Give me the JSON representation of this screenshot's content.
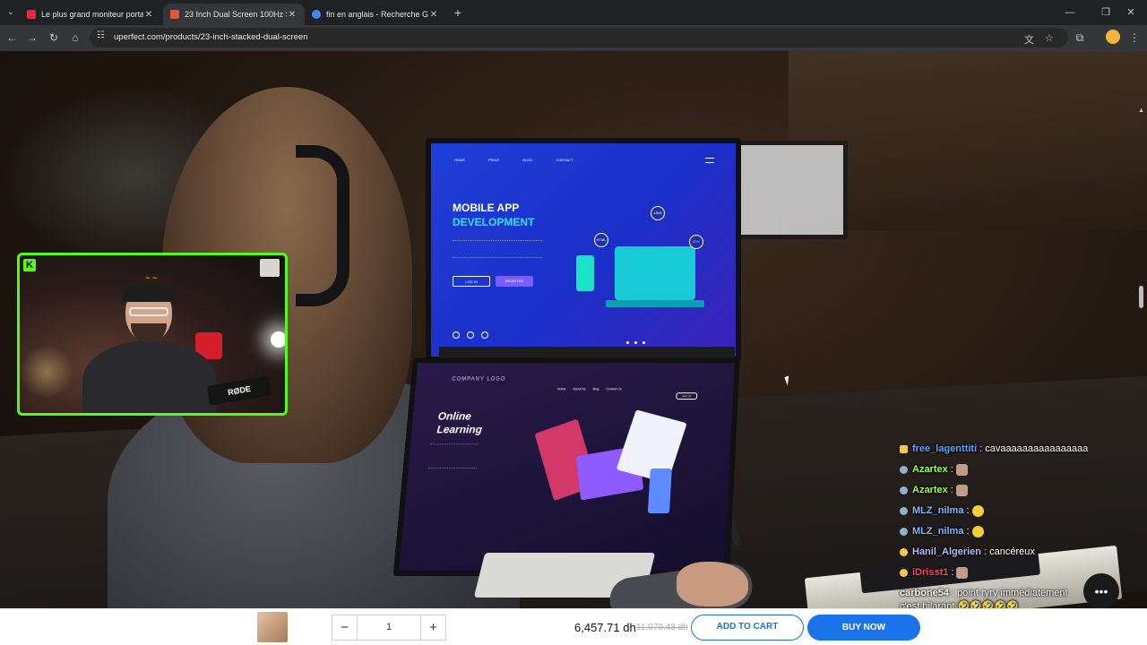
{
  "browser": {
    "tabs": [
      {
        "title": "Le plus grand moniteur portabl",
        "favicon_color": "#e5283b",
        "active": false
      },
      {
        "title": "23 Inch Dual Screen 100Hz Stac",
        "favicon_color": "#e0553a",
        "active": true
      },
      {
        "title": "fin en anglais - Recherche Goog",
        "favicon_color": "#4285f4",
        "active": false
      }
    ],
    "url": "uperfect.com/products/23-inch-stacked-dual-screen",
    "icons": {
      "tab_menu": "chevron-down-icon",
      "close": "close-icon",
      "new_tab": "plus-icon",
      "back": "back-arrow-icon",
      "forward": "forward-arrow-icon",
      "reload": "reload-icon",
      "home": "home-icon",
      "translate": "translate-icon",
      "bookmark": "star-icon",
      "extensions": "puzzle-icon",
      "menu": "kebab-menu-icon"
    }
  },
  "top_screen": {
    "nav": [
      "HOME",
      "PRICE",
      "BLOG",
      "CONTACT"
    ],
    "title_line1": "MOBILE APP",
    "title_line2": "DEVELOPMENT",
    "login_label": "LOG IN",
    "register_label": "REGISTER",
    "chips": [
      "JAVA",
      "HTML",
      "C++"
    ]
  },
  "bottom_screen": {
    "logo": "COMPANY LOGO",
    "nav": [
      "Home",
      "About Us",
      "Blog",
      "Contact Us"
    ],
    "button": "Join Us",
    "title_line1": "Online",
    "title_line2": "Learning"
  },
  "webcam": {
    "logo": "K",
    "mic_brand": "RØDE",
    "border_color": "#53fc18"
  },
  "chat": {
    "messages": [
      {
        "user": "free_lagenttiti",
        "color": "#5aa2ff",
        "badge_color": "#f2c94c",
        "text": "cavaaaaaaaaaaaaaaaa",
        "emotes": 0
      },
      {
        "user": "Azartex",
        "color": "#9bff52",
        "badge_color": "#8fb1c9",
        "text": "",
        "emotes": 1
      },
      {
        "user": "Azartex",
        "color": "#9bff52",
        "badge_color": "#8fb1c9",
        "text": "",
        "emotes": 1
      },
      {
        "user": "MLZ_nilma",
        "color": "#7fb7ff",
        "badge_color": "#8fb1c9",
        "text": "",
        "emotes": 1,
        "emote_style": "y"
      },
      {
        "user": "MLZ_nilma",
        "color": "#7fb7ff",
        "badge_color": "#8fb1c9",
        "text": "",
        "emotes": 1,
        "emote_style": "y"
      },
      {
        "user": "Hanil_Algerien",
        "color": "#b8b8ff",
        "badge_color": "#f2c94c",
        "text": "cancéreux",
        "emotes": 0
      },
      {
        "user": "iDrisst1",
        "color": "#ff3d6a",
        "badge_color": "#f2c94c",
        "text": "",
        "emotes": 1
      },
      {
        "user": "carbone54",
        "color": "#ffffff",
        "badge_color": "",
        "text": "point ryry immédiatement",
        "emotes": 0
      }
    ],
    "continuation": "c'est hilarant 🤣🤣🤣🤣🤣"
  },
  "help_icon": "chat-bubble-icon",
  "cart": {
    "quantity": "1",
    "minus": "−",
    "plus": "+",
    "price": "6,457.71 dh",
    "old_price": "11,070.43 dh",
    "add_to_cart": "ADD TO CART",
    "buy_now": "BUY NOW",
    "accent_color": "#1a73e8"
  }
}
